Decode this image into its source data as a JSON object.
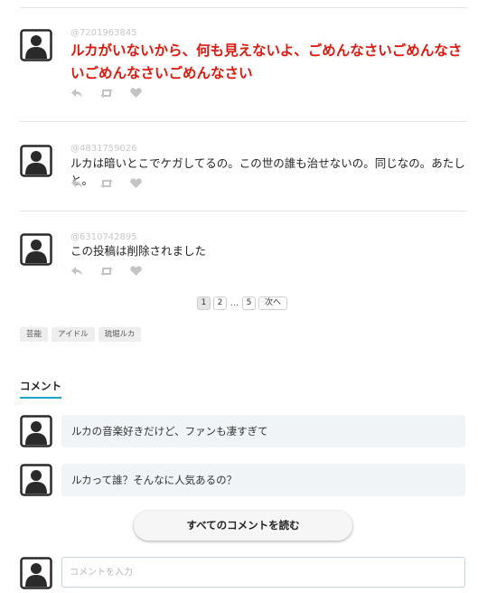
{
  "posts": [
    {
      "uid": "@7201963845",
      "text": "ルカがいないから、何も見えないよ、ごめんなさいごめんなさいごめんなさいごめんなさい",
      "highlight": true
    },
    {
      "uid": "@4831759026",
      "text": "ルカは暗いとこでケガしてるの。この世の誰も治せないの。同じなの。あたしと。",
      "highlight": false
    },
    {
      "uid": "@6310742895",
      "text": "この投稿は削除されました",
      "highlight": false
    }
  ],
  "pagination": {
    "pages": [
      "1",
      "2"
    ],
    "ellipsis": "…",
    "last": "5",
    "next_label": "次へ",
    "current": "1"
  },
  "tags": [
    "芸能",
    "アイドル",
    "琉堀ルカ"
  ],
  "comments": {
    "heading": "コメント",
    "items": [
      {
        "text": "ルカの音楽好きだけど、ファンも凄すぎて"
      },
      {
        "text": "ルカって誰？そんなに人気あるの？"
      }
    ],
    "read_all_label": "すべてのコメントを読む",
    "input_placeholder": "コメントを入力"
  },
  "icons": [
    "avatar-icon",
    "reply-icon",
    "retweet-icon",
    "heart-icon"
  ],
  "colors": {
    "highlight_text": "#e0190f",
    "accent_underline": "#1aa5cc",
    "bubble_bg": "#f1f4f7"
  }
}
